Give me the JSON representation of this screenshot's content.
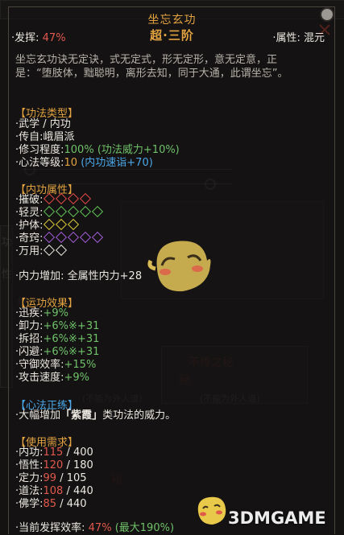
{
  "title": "坐忘玄功",
  "rank": "超·三阶",
  "header": {
    "left_prefix": "·发挥:",
    "left_value": "47%",
    "right_text": "·属性: 混元"
  },
  "description": "坐忘玄功诀无定诀，式无定式，形无定形，意无定意，正是：“堕肢体，黜聪明，离形去知，同于大通，此谓坐忘”。",
  "technique_type": {
    "heading": "【功法类型】",
    "martial": "·武学 / 内功",
    "sect_prefix": "·传自:",
    "sect_value": "峨眉派",
    "practice_prefix": "·修习程度:",
    "practice_value": "100%",
    "practice_bonus": "(功法威力+10%)",
    "heart_prefix": "·心法等级:",
    "heart_value": "10",
    "heart_bonus": "(内功速诣+70)"
  },
  "internal_attributes": {
    "heading": "【内功属性】",
    "rows": [
      {
        "label": "·摧破:",
        "count": 4,
        "color": "red"
      },
      {
        "label": "·轻灵:",
        "count": 5,
        "color": "green"
      },
      {
        "label": "·护体:",
        "count": 3,
        "color": "yellow"
      },
      {
        "label": "·奇窍:",
        "count": 5,
        "color": "purple"
      },
      {
        "label": "·万用:",
        "count": 2,
        "color": "white"
      }
    ]
  },
  "internal_boost": {
    "prefix": "·内力增加:",
    "value": "全属性内力+28"
  },
  "movement_effects": {
    "heading": "【运功效果】",
    "rows": [
      {
        "label": "·迅疾:",
        "value": "+9%"
      },
      {
        "label": "·卸力:",
        "value": "+6%※+31"
      },
      {
        "label": "·拆招:",
        "value": "+6%※+31"
      },
      {
        "label": "·闪避:",
        "value": "+6%※+31"
      },
      {
        "label": "·守御效率:",
        "value": "+15%"
      },
      {
        "label": "·攻击速度:",
        "value": "+9%"
      }
    ]
  },
  "heart_method": {
    "heading": "【心法正练】",
    "text_before": "·大幅增加",
    "highlight": "「紫霞」",
    "text_after": "类功法的威力。"
  },
  "requirements": {
    "heading": "【使用需求】",
    "rows": [
      {
        "label": "·内功:",
        "current": "115",
        "required": "400"
      },
      {
        "label": "·悟性:",
        "current": "120",
        "required": "180"
      },
      {
        "label": "·定力:",
        "current": "99",
        "required": "105"
      },
      {
        "label": "·道法:",
        "current": "108",
        "required": "440"
      },
      {
        "label": "·佛学:",
        "current": "85",
        "required": "440"
      }
    ]
  },
  "footer": {
    "prefix": "·当前发挥效率:",
    "value": "47%",
    "max": "(最大190%)"
  },
  "watermark": "3DMGAME",
  "background_ghost_text": [
    "功",
    "性",
    "绝",
    "不传之秘",
    "(不能为外人道)",
    "(不能为外人道)",
    "秘",
    "秘"
  ],
  "colors": {
    "accent": "#e2a340",
    "negative": "#e2594d",
    "positive": "#6fc26a",
    "info": "#4aa8e8"
  }
}
